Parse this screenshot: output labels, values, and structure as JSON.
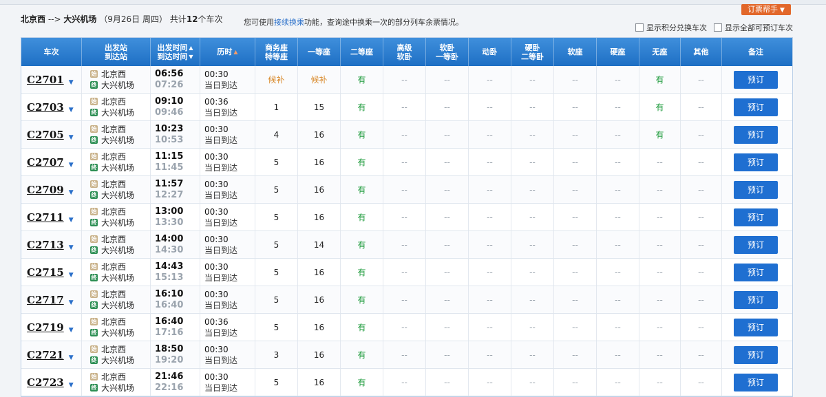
{
  "header": {
    "route_from": "北京西",
    "route_arrow": "-->",
    "route_to": "大兴机场",
    "date": "（9月26日  周四）",
    "count_prefix": "共计",
    "count": "12",
    "count_suffix": "个车次",
    "notice_pre": "您可使用",
    "notice_link": "接续换乘",
    "notice_post": "功能，查询途中换乘一次的部分列车余票情况。",
    "help_label": "订票帮手",
    "option_points": "显示积分兑换车次",
    "option_all": "显示全部可预订车次"
  },
  "columns": {
    "train": "车次",
    "station_top": "出发站",
    "station_bottom": "到达站",
    "time_top": "出发时间",
    "time_bottom": "到达时间",
    "duration": "历时",
    "business_top": "商务座",
    "business_bottom": "特等座",
    "first": "一等座",
    "second": "二等座",
    "premium_top": "高级",
    "premium_bottom": "软卧",
    "soft_top": "软卧",
    "soft_bottom": "一等卧",
    "motion": "动卧",
    "hard_top": "硬卧",
    "hard_bottom": "二等卧",
    "soft_seat": "软座",
    "hard_seat": "硬座",
    "no_seat": "无座",
    "other": "其他",
    "remark": "备注"
  },
  "badges": {
    "start": "始",
    "end": "终"
  },
  "book_label": "预订",
  "trains": [
    {
      "no": "C2701",
      "from": "北京西",
      "to": "大兴机场",
      "dep": "06:56",
      "arr": "07:26",
      "dur": "00:30",
      "day": "当日到达",
      "business": "候补",
      "first": "候补",
      "second": "有",
      "premium": "--",
      "soft": "--",
      "motion": "--",
      "hard": "--",
      "soft_seat": "--",
      "hard_seat": "--",
      "no_seat": "有",
      "other": "--"
    },
    {
      "no": "C2703",
      "from": "北京西",
      "to": "大兴机场",
      "dep": "09:10",
      "arr": "09:46",
      "dur": "00:36",
      "day": "当日到达",
      "business": "1",
      "first": "15",
      "second": "有",
      "premium": "--",
      "soft": "--",
      "motion": "--",
      "hard": "--",
      "soft_seat": "--",
      "hard_seat": "--",
      "no_seat": "有",
      "other": "--"
    },
    {
      "no": "C2705",
      "from": "北京西",
      "to": "大兴机场",
      "dep": "10:23",
      "arr": "10:53",
      "dur": "00:30",
      "day": "当日到达",
      "business": "4",
      "first": "16",
      "second": "有",
      "premium": "--",
      "soft": "--",
      "motion": "--",
      "hard": "--",
      "soft_seat": "--",
      "hard_seat": "--",
      "no_seat": "有",
      "other": "--"
    },
    {
      "no": "C2707",
      "from": "北京西",
      "to": "大兴机场",
      "dep": "11:15",
      "arr": "11:45",
      "dur": "00:30",
      "day": "当日到达",
      "business": "5",
      "first": "16",
      "second": "有",
      "premium": "--",
      "soft": "--",
      "motion": "--",
      "hard": "--",
      "soft_seat": "--",
      "hard_seat": "--",
      "no_seat": "--",
      "other": "--"
    },
    {
      "no": "C2709",
      "from": "北京西",
      "to": "大兴机场",
      "dep": "11:57",
      "arr": "12:27",
      "dur": "00:30",
      "day": "当日到达",
      "business": "5",
      "first": "16",
      "second": "有",
      "premium": "--",
      "soft": "--",
      "motion": "--",
      "hard": "--",
      "soft_seat": "--",
      "hard_seat": "--",
      "no_seat": "--",
      "other": "--"
    },
    {
      "no": "C2711",
      "from": "北京西",
      "to": "大兴机场",
      "dep": "13:00",
      "arr": "13:30",
      "dur": "00:30",
      "day": "当日到达",
      "business": "5",
      "first": "16",
      "second": "有",
      "premium": "--",
      "soft": "--",
      "motion": "--",
      "hard": "--",
      "soft_seat": "--",
      "hard_seat": "--",
      "no_seat": "--",
      "other": "--"
    },
    {
      "no": "C2713",
      "from": "北京西",
      "to": "大兴机场",
      "dep": "14:00",
      "arr": "14:30",
      "dur": "00:30",
      "day": "当日到达",
      "business": "5",
      "first": "14",
      "second": "有",
      "premium": "--",
      "soft": "--",
      "motion": "--",
      "hard": "--",
      "soft_seat": "--",
      "hard_seat": "--",
      "no_seat": "--",
      "other": "--"
    },
    {
      "no": "C2715",
      "from": "北京西",
      "to": "大兴机场",
      "dep": "14:43",
      "arr": "15:13",
      "dur": "00:30",
      "day": "当日到达",
      "business": "5",
      "first": "16",
      "second": "有",
      "premium": "--",
      "soft": "--",
      "motion": "--",
      "hard": "--",
      "soft_seat": "--",
      "hard_seat": "--",
      "no_seat": "--",
      "other": "--"
    },
    {
      "no": "C2717",
      "from": "北京西",
      "to": "大兴机场",
      "dep": "16:10",
      "arr": "16:40",
      "dur": "00:30",
      "day": "当日到达",
      "business": "5",
      "first": "16",
      "second": "有",
      "premium": "--",
      "soft": "--",
      "motion": "--",
      "hard": "--",
      "soft_seat": "--",
      "hard_seat": "--",
      "no_seat": "--",
      "other": "--"
    },
    {
      "no": "C2719",
      "from": "北京西",
      "to": "大兴机场",
      "dep": "16:40",
      "arr": "17:16",
      "dur": "00:36",
      "day": "当日到达",
      "business": "5",
      "first": "16",
      "second": "有",
      "premium": "--",
      "soft": "--",
      "motion": "--",
      "hard": "--",
      "soft_seat": "--",
      "hard_seat": "--",
      "no_seat": "--",
      "other": "--"
    },
    {
      "no": "C2721",
      "from": "北京西",
      "to": "大兴机场",
      "dep": "18:50",
      "arr": "19:20",
      "dur": "00:30",
      "day": "当日到达",
      "business": "3",
      "first": "16",
      "second": "有",
      "premium": "--",
      "soft": "--",
      "motion": "--",
      "hard": "--",
      "soft_seat": "--",
      "hard_seat": "--",
      "no_seat": "--",
      "other": "--"
    },
    {
      "no": "C2723",
      "from": "北京西",
      "to": "大兴机场",
      "dep": "21:46",
      "arr": "22:16",
      "dur": "00:30",
      "day": "当日到达",
      "business": "5",
      "first": "16",
      "second": "有",
      "premium": "--",
      "soft": "--",
      "motion": "--",
      "hard": "--",
      "soft_seat": "--",
      "hard_seat": "--",
      "no_seat": "--",
      "other": "--"
    }
  ]
}
